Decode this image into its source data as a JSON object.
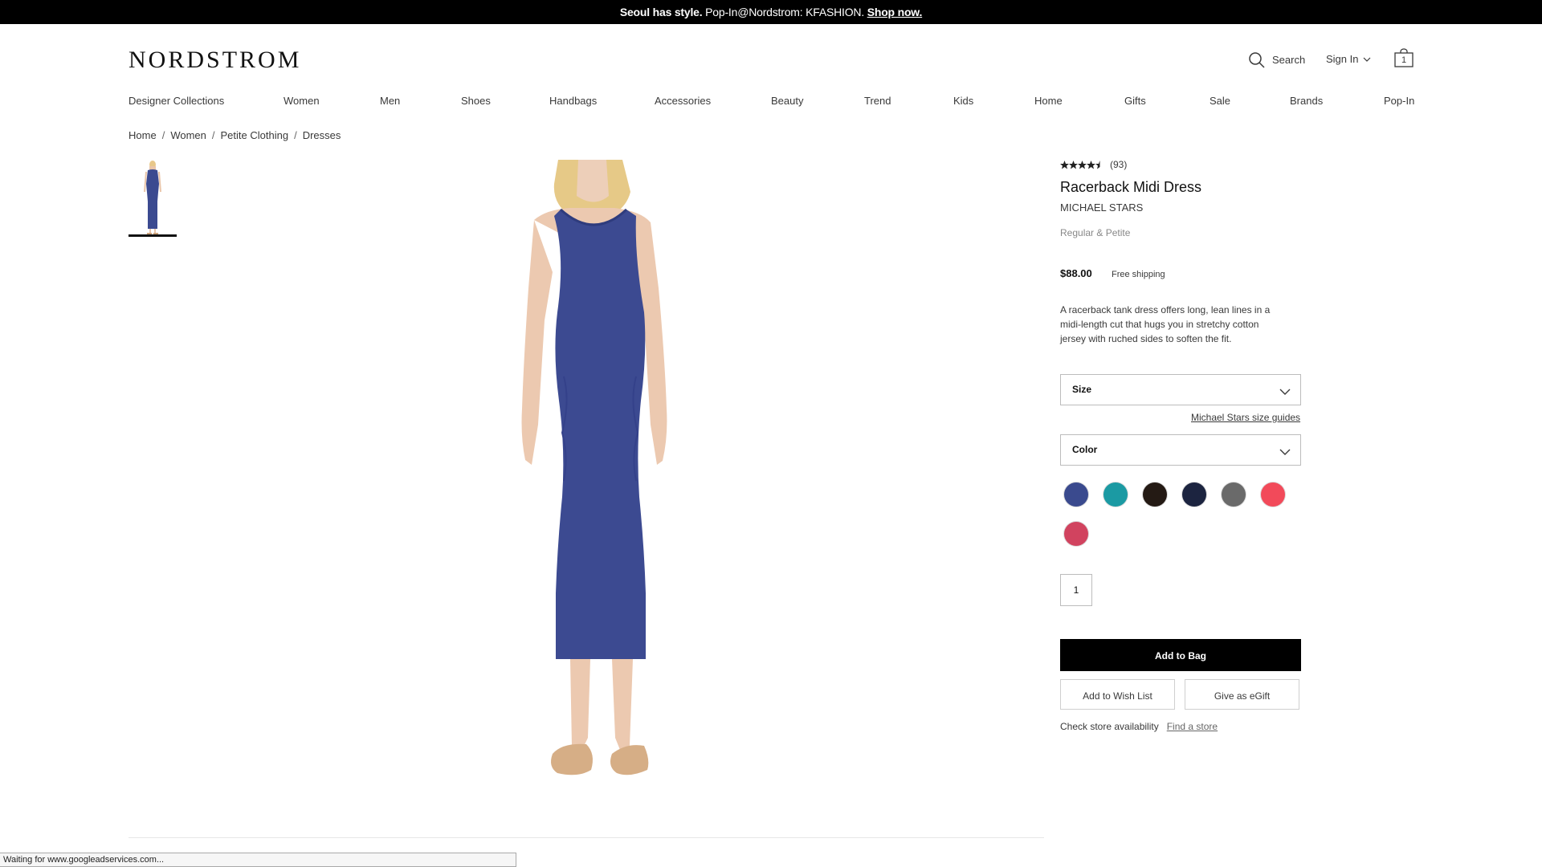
{
  "promo": {
    "bold_text": "Seoul has style.",
    "text": " Pop-In@Nordstrom: KFASHION. ",
    "link": "Shop now."
  },
  "header": {
    "logo": "NORDSTROM",
    "search_label": "Search",
    "signin_label": "Sign In",
    "bag_count": "1"
  },
  "nav": {
    "items": [
      "Designer Collections",
      "Women",
      "Men",
      "Shoes",
      "Handbags",
      "Accessories",
      "Beauty",
      "Trend",
      "Kids",
      "Home",
      "Gifts",
      "Sale",
      "Brands",
      "Pop-In"
    ]
  },
  "breadcrumb": {
    "items": [
      "Home",
      "Women",
      "Petite Clothing",
      "Dresses"
    ],
    "separator": "/"
  },
  "product": {
    "rating": 4.5,
    "review_count": "(93)",
    "title": "Racerback Midi Dress",
    "brand": "MICHAEL STARS",
    "fit": "Regular & Petite",
    "price": "$88.00",
    "shipping": "Free shipping",
    "description": "A racerback tank dress offers long, lean lines in a midi-length cut that hugs you in stretchy cotton jersey with ruched sides to soften the fit.",
    "size_label": "Size",
    "size_guide": "Michael Stars size guides",
    "color_label": "Color",
    "swatches": [
      "#3a4a8e",
      "#1b9aa3",
      "#241a14",
      "#1c2440",
      "#6a6a6a",
      "#f24a5a",
      "#d1435f"
    ],
    "quantity": "1",
    "add_to_bag": "Add to Bag",
    "wish_list": "Add to Wish List",
    "egift": "Give as eGift",
    "store_text": "Check store availability",
    "store_link": "Find a store"
  },
  "status_bar": "Waiting for www.googleadservices.com..."
}
